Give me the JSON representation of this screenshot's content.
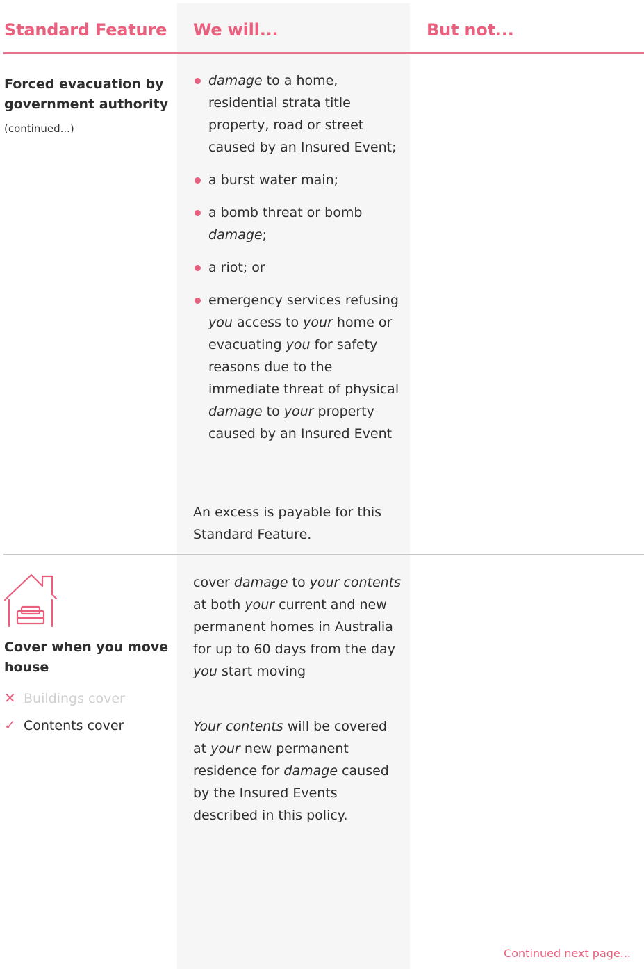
{
  "columns": {
    "standard_feature": "Standard Feature",
    "we_will": "We will...",
    "but_not": "But not..."
  },
  "section1": {
    "title": "Forced evacuation by government authority",
    "note": "(continued...)",
    "bullets": [
      {
        "html": "<em>damage</em> to a home, residential strata title property, road or street caused by an Insured Event;"
      },
      {
        "html": "a burst water main;"
      },
      {
        "html": "a bomb threat or bomb <em>damage</em>;"
      },
      {
        "html": "a riot; or"
      },
      {
        "html": "emergency services refusing <em>you</em> access to <em>your</em> home or evacuating <em>you</em> for safety reasons due to the immediate threat of physical <em>damage</em> to <em>your</em> property caused by an Insured Event"
      }
    ],
    "excess_note": "An excess is payable for this Standard Feature."
  },
  "section2": {
    "icon": "house-with-sofa-icon",
    "title": "Cover when you move house",
    "buildings_cover": {
      "label": "Buildings cover",
      "included": false,
      "icon": "cross-icon"
    },
    "contents_cover": {
      "label": "Contents cover",
      "included": true,
      "icon": "check-icon"
    },
    "paragraph1_html": "cover <em>damage</em> to <em>your contents</em> at both <em>your</em> current and new permanent homes in Australia for up to 60 days from the day <em>you</em> start moving",
    "paragraph2_html": "<em>Your contents</em> will be covered at <em>your</em> new permanent residence for <em>damage</em> caused by the Insured Events described in this policy."
  },
  "footer": {
    "continued": "Continued next page..."
  },
  "colors": {
    "accent": "#e9607e",
    "column_shade": "#f6f6f6",
    "divider": "#c8c8c8",
    "excluded_text": "#d0d0d0"
  }
}
